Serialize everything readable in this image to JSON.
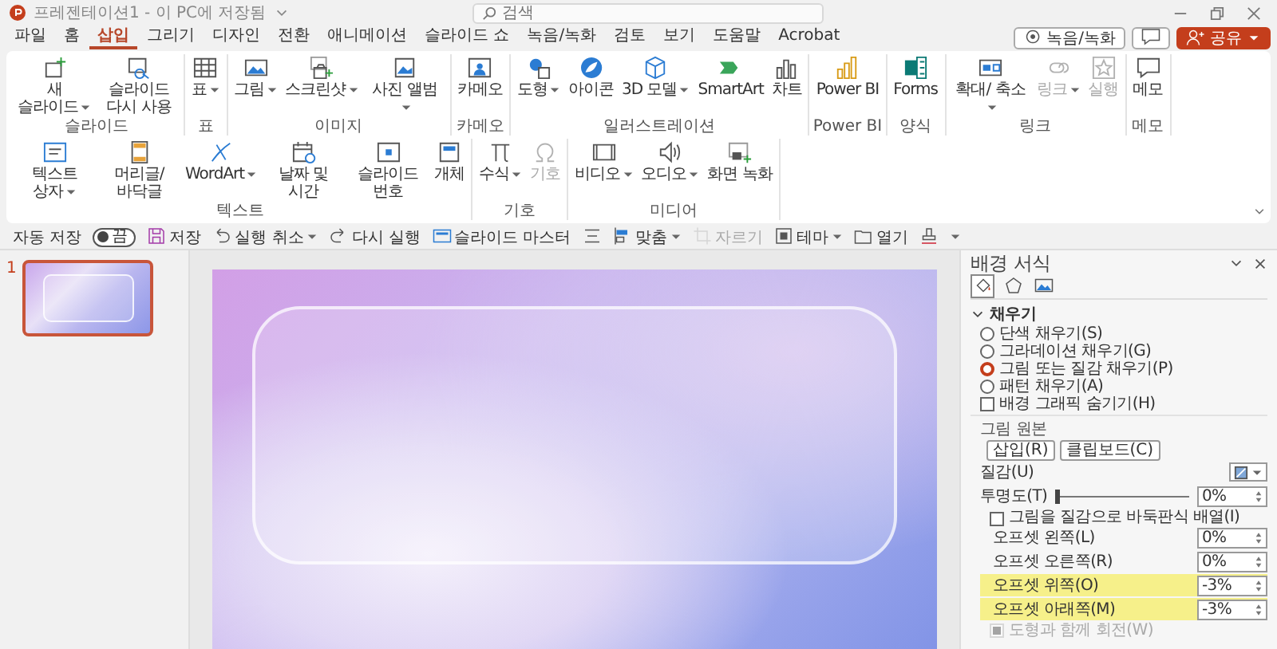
{
  "title_bar": {
    "document_title": "프레젠테이션1 - 이 PC에 저장됨",
    "search": {
      "placeholder": "검색"
    }
  },
  "tabs": [
    {
      "label": "파일",
      "selected": false
    },
    {
      "label": "홈",
      "selected": false
    },
    {
      "label": "삽입",
      "selected": true
    },
    {
      "label": "그리기",
      "selected": false
    },
    {
      "label": "디자인",
      "selected": false
    },
    {
      "label": "전환",
      "selected": false
    },
    {
      "label": "애니메이션",
      "selected": false
    },
    {
      "label": "슬라이드 쇼",
      "selected": false
    },
    {
      "label": "녹음/녹화",
      "selected": false
    },
    {
      "label": "검토",
      "selected": false
    },
    {
      "label": "보기",
      "selected": false
    },
    {
      "label": "도움말",
      "selected": false
    },
    {
      "label": "Acrobat",
      "selected": false
    }
  ],
  "header_buttons": [
    {
      "kind": "record",
      "label": "녹음/녹화"
    },
    {
      "kind": "comment"
    },
    {
      "kind": "share",
      "label": "공유"
    }
  ],
  "ribbon": {
    "groups": [
      {
        "label": "슬라이드",
        "buttons": [
          {
            "kind": "newslide",
            "label": "새 슬라이드",
            "dropdown": true,
            "disabled": false
          },
          {
            "kind": "reuse",
            "label": "슬라이드 다시 사용",
            "dropdown": false,
            "disabled": false
          }
        ]
      },
      {
        "label": "표",
        "buttons": [
          {
            "kind": "table",
            "label": "표",
            "dropdown": true,
            "disabled": false
          }
        ]
      },
      {
        "label": "이미지",
        "buttons": [
          {
            "kind": "picture",
            "label": "그림",
            "dropdown": true,
            "disabled": false
          },
          {
            "kind": "screenshot",
            "label": "스크린샷",
            "dropdown": true,
            "disabled": false
          },
          {
            "kind": "album",
            "label": "사진 앨범",
            "dropdown": true,
            "disabled": false
          }
        ]
      },
      {
        "label": "카메오",
        "buttons": [
          {
            "kind": "cameo",
            "label": "카메오",
            "dropdown": false,
            "disabled": false
          }
        ]
      },
      {
        "label": "일러스트레이션",
        "buttons": [
          {
            "kind": "shapes",
            "label": "도형",
            "dropdown": true,
            "disabled": false
          },
          {
            "kind": "iconset",
            "label": "아이콘",
            "dropdown": false,
            "disabled": false
          },
          {
            "kind": "model3d",
            "label": "3D 모델",
            "dropdown": true,
            "disabled": false
          },
          {
            "kind": "smartart",
            "label": "SmartArt",
            "dropdown": false,
            "disabled": false
          },
          {
            "kind": "chart",
            "label": "차트",
            "dropdown": false,
            "disabled": false
          }
        ]
      },
      {
        "label": "Power BI",
        "buttons": [
          {
            "kind": "powerbi",
            "label": "Power BI",
            "dropdown": false,
            "disabled": false
          }
        ]
      },
      {
        "label": "양식",
        "buttons": [
          {
            "kind": "forms",
            "label": "Forms",
            "dropdown": false,
            "disabled": false
          }
        ]
      },
      {
        "label": "링크",
        "buttons": [
          {
            "kind": "zoom",
            "label": "확대/ 축소",
            "dropdown": true,
            "disabled": false
          },
          {
            "kind": "link",
            "label": "링크",
            "dropdown": true,
            "disabled": true
          },
          {
            "kind": "action",
            "label": "실행",
            "dropdown": false,
            "disabled": true
          }
        ]
      },
      {
        "label": "메모",
        "buttons": [
          {
            "kind": "comment",
            "label": "메모",
            "dropdown": false,
            "disabled": false
          }
        ]
      },
      {
        "label": "텍스트",
        "buttons": [
          {
            "kind": "textbox",
            "label": "텍스트 상자",
            "dropdown": true,
            "disabled": false
          },
          {
            "kind": "headerfooter",
            "label": "머리글/ 바닥글",
            "dropdown": false,
            "disabled": false
          },
          {
            "kind": "wordart",
            "label": "WordArt",
            "dropdown": true,
            "disabled": false
          },
          {
            "kind": "datetime",
            "label": "날짜 및 시간",
            "dropdown": false,
            "disabled": false
          },
          {
            "kind": "slidenumber",
            "label": "슬라이드 번호",
            "dropdown": false,
            "disabled": false
          },
          {
            "kind": "object",
            "label": "개체",
            "dropdown": false,
            "disabled": false
          }
        ]
      },
      {
        "label": "기호",
        "buttons": [
          {
            "kind": "equation",
            "label": "수식",
            "dropdown": true,
            "disabled": false
          },
          {
            "kind": "symbol",
            "label": "기호",
            "dropdown": false,
            "disabled": true
          }
        ]
      },
      {
        "label": "미디어",
        "buttons": [
          {
            "kind": "video",
            "label": "비디오",
            "dropdown": true,
            "disabled": false
          },
          {
            "kind": "audio",
            "label": "오디오",
            "dropdown": true,
            "disabled": false
          },
          {
            "kind": "screenrec",
            "label": "화면 녹화",
            "dropdown": false,
            "disabled": false
          }
        ]
      }
    ]
  },
  "quick_access": [
    {
      "kind": "toggle",
      "label": "자동 저장",
      "state_label": "끔",
      "on": false
    },
    {
      "kind": "save",
      "label": "저장",
      "dropdown": false,
      "disabled": false
    },
    {
      "kind": "undo",
      "label": "실행 취소",
      "dropdown": true,
      "disabled": false
    },
    {
      "kind": "redo",
      "label": "다시 실행",
      "dropdown": false,
      "disabled": false
    },
    {
      "kind": "master",
      "label": "슬라이드 마스터",
      "dropdown": false,
      "disabled": false
    },
    {
      "kind": "distribute",
      "dropdown": false,
      "disabled": false
    },
    {
      "kind": "align",
      "label": "맞춤",
      "dropdown": true,
      "disabled": false
    },
    {
      "kind": "crop",
      "label": "자르기",
      "dropdown": false,
      "disabled": true
    },
    {
      "kind": "theme",
      "label": "테마",
      "dropdown": true,
      "disabled": false
    },
    {
      "kind": "open",
      "label": "열기",
      "dropdown": false,
      "disabled": false
    },
    {
      "kind": "stamp",
      "dropdown": false,
      "disabled": false
    },
    {
      "kind": "more",
      "dropdown": true,
      "disabled": false
    }
  ],
  "slides_pane": {
    "slides": [
      {
        "number": "1",
        "selected": true
      }
    ]
  },
  "format_pane": {
    "title": "배경 서식",
    "tabs": [
      {
        "kind": "fill",
        "selected": true
      },
      {
        "kind": "effects",
        "selected": false
      },
      {
        "kind": "picture",
        "selected": false
      }
    ],
    "section": {
      "title": "채우기",
      "expanded": true
    },
    "fill_options": [
      {
        "label": "단색 채우기(S)",
        "selected": false
      },
      {
        "label": "그라데이션 채우기(G)",
        "selected": false
      },
      {
        "label": "그림 또는 질감 채우기(P)",
        "selected": true
      },
      {
        "label": "패턴 채우기(A)",
        "selected": false
      }
    ],
    "hide_background_graphics": {
      "label": "배경 그래픽 숨기기(H)",
      "checked": false
    },
    "picture_source": {
      "label": "그림 원본",
      "buttons": [
        "삽입(R)",
        "클립보드(C)"
      ]
    },
    "texture": {
      "label": "질감(U)"
    },
    "transparency": {
      "label": "투명도(T)",
      "level": 0,
      "value": "0%"
    },
    "tile": {
      "label": "그림을 질감으로 바둑판식 배열(I)",
      "checked": false
    },
    "offsets": [
      {
        "label": "오프셋 왼쪽(L)",
        "value": "0%",
        "highlighted": false
      },
      {
        "label": "오프셋 오른쪽(R)",
        "value": "0%",
        "highlighted": false
      },
      {
        "label": "오프셋 위쪽(O)",
        "value": "-3%",
        "highlighted": true
      },
      {
        "label": "오프셋 아래쪽(M)",
        "value": "-3%",
        "highlighted": true
      }
    ],
    "rotate": {
      "label": "도형과 함께 회전(W)",
      "checked": true,
      "disabled": true
    }
  }
}
